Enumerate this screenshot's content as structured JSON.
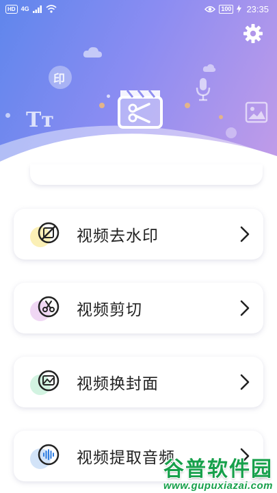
{
  "status_bar": {
    "hd_badge": "HD",
    "network": "4G",
    "battery": "100",
    "time": "23:35"
  },
  "header": {
    "deco_text_1": "印",
    "deco_text_2": "Tт"
  },
  "menu": {
    "items": [
      {
        "label": "视频去水印",
        "icon": "no-watermark-icon",
        "accent": "#f7e37a"
      },
      {
        "label": "视频剪切",
        "icon": "scissors-icon",
        "accent": "#e9c6ef"
      },
      {
        "label": "视频换封面",
        "icon": "image-frame-icon",
        "accent": "#bfeed4"
      },
      {
        "label": "视频提取音频",
        "icon": "audio-wave-icon",
        "accent": "#c7dcf6"
      }
    ]
  },
  "watermark": {
    "title": "谷普软件园",
    "url": "www.gupuxiazai.com"
  },
  "colors": {
    "header_gradient_start": "#5f86ec",
    "header_gradient_end": "#c29ce8",
    "text": "#222222",
    "watermark_green": "#17a04b"
  }
}
